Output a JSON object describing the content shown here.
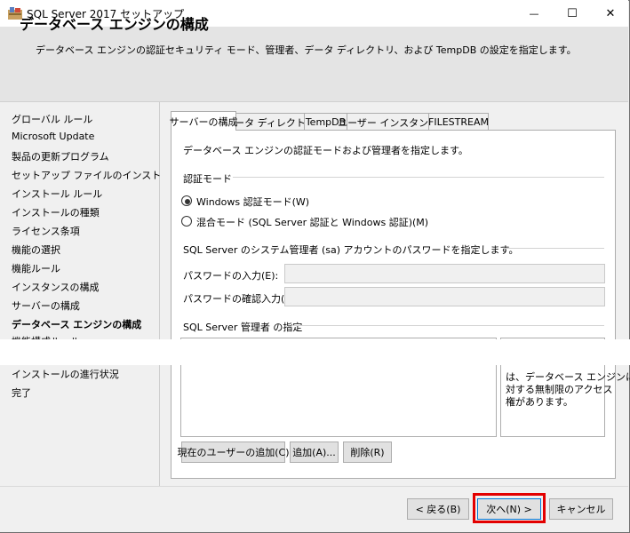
{
  "window": {
    "title": "SQL Server 2017 セットアップ",
    "minimize_glyph": "—",
    "maximize_glyph": "☐",
    "close_glyph": "✕"
  },
  "header": {
    "title": "データベース エンジンの構成",
    "description": "データベース エンジンの認証セキュリティ モード、管理者、データ ディレクトリ、および TempDB の設定を指定します。"
  },
  "sidebar": {
    "items": [
      {
        "label": "グローバル ルール"
      },
      {
        "label": "Microsoft Update"
      },
      {
        "label": "製品の更新プログラム"
      },
      {
        "label": "セットアップ ファイルのインストール"
      },
      {
        "label": "インストール ルール"
      },
      {
        "label": "インストールの種類"
      },
      {
        "label": "ライセンス条項"
      },
      {
        "label": "機能の選択"
      },
      {
        "label": "機能ルール"
      },
      {
        "label": "インスタンスの構成"
      },
      {
        "label": "サーバーの構成"
      },
      {
        "label": "データベース エンジンの構成"
      },
      {
        "label": "機能構成ルール"
      },
      {
        "label": "インストールの進行状況"
      },
      {
        "label": "完了"
      }
    ]
  },
  "tabs": [
    {
      "label": "サーバーの構成"
    },
    {
      "label": "データ ディレクトリ"
    },
    {
      "label": "TempDB"
    },
    {
      "label": "ユーザー インスタンス"
    },
    {
      "label": "FILESTREAM"
    }
  ],
  "panel": {
    "intro": "データベース エンジンの認証モードおよび管理者を指定します。",
    "auth_group": "認証モード",
    "auth_windows": "Windows 認証モード(W)",
    "auth_mixed": "混合モード (SQL Server 認証と Windows 認証)(M)",
    "sa_group": "SQL Server のシステム管理者 (sa) アカウントのパスワードを指定します。",
    "password_label": "パスワードの入力(E):",
    "confirm_label": "パスワードの確認入力(O):",
    "admin_group": "SQL Server 管理者 の指定",
    "admin_info_1": "は、データベース エンジンに",
    "admin_info_2": "対する無制限のアクセス",
    "admin_info_3": "権があります。",
    "add_current_user": "現在のユーザーの追加(C)",
    "add": "追加(A)...",
    "remove": "削除(R)"
  },
  "footer": {
    "back": "< 戻る(B)",
    "next": "次へ(N) >",
    "cancel": "キャンセル"
  }
}
